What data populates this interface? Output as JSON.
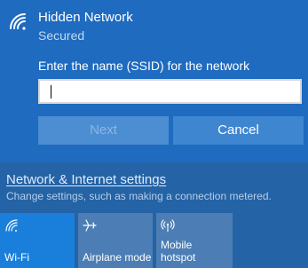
{
  "network": {
    "name": "Hidden Network",
    "status": "Secured",
    "ssid_prompt": "Enter the name (SSID) for the network",
    "ssid_value": "",
    "next_label": "Next",
    "cancel_label": "Cancel"
  },
  "settings": {
    "link_label": "Network & Internet settings",
    "description": "Change settings, such as making a connection metered."
  },
  "quick_actions": [
    {
      "label": "Wi-Fi",
      "icon": "wifi-icon",
      "active": true
    },
    {
      "label": "Airplane mode",
      "icon": "airplane-icon",
      "active": false
    },
    {
      "label": "Mobile\nhotspot",
      "icon": "hotspot-icon",
      "active": false
    }
  ],
  "colors": {
    "panel_bg": "#1e6bc0",
    "settings_bg": "#2463a6",
    "tile_active": "#1a7fda",
    "tile_inactive": "#4c7eb5"
  }
}
